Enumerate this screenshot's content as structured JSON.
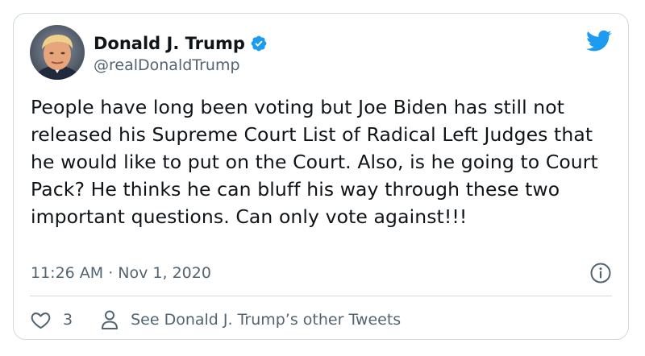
{
  "author": {
    "display_name": "Donald J. Trump",
    "handle": "@realDonaldTrump",
    "verified": true,
    "avatar_icon": "profile-photo"
  },
  "tweet": {
    "text": "People have long been voting but Joe Biden has still not released his Supreme Court List of Radical Left Judges that he would like to put on the Court. Also, is he going to Court Pack? He thinks he can bluff his way through these two important questions. Can only vote against!!!",
    "timestamp": "11:26 AM · Nov 1, 2020"
  },
  "actions": {
    "like_count": "3",
    "other_tweets_label": "See Donald J. Trump’s other Tweets"
  },
  "icons": {
    "brand": "twitter-bird-icon",
    "verified": "verified-badge-icon",
    "info": "info-icon",
    "like": "heart-icon",
    "profile": "person-icon"
  },
  "colors": {
    "twitter_blue": "#1d9bf0",
    "text_primary": "#0f1419",
    "text_secondary": "#536471",
    "border": "#cfd9de"
  }
}
